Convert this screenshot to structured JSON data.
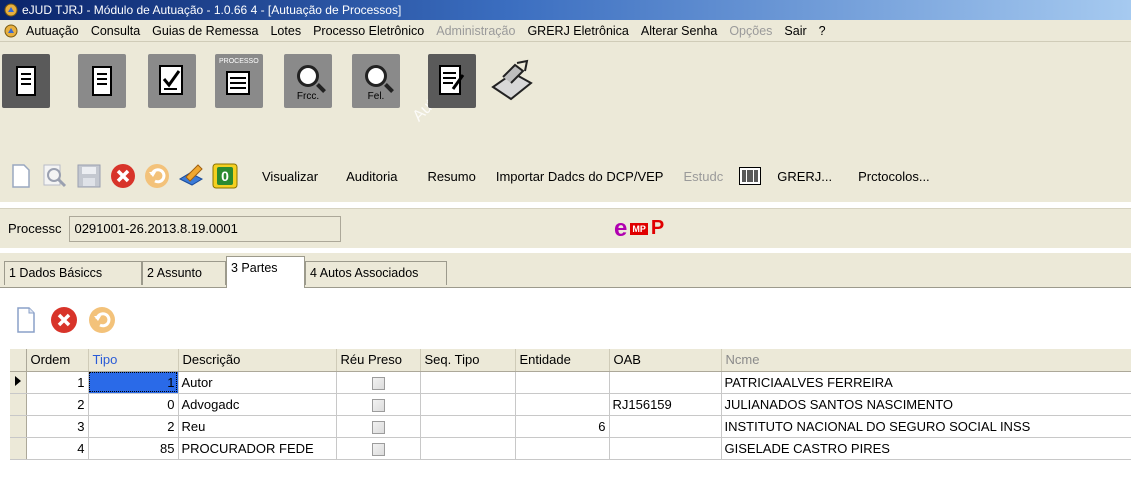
{
  "window": {
    "title": "eJUD TJRJ - Módulo de Autuação - 1.0.66 4 - [Autuação de Processos]"
  },
  "menu": [
    {
      "label": "Autuação",
      "disabled": false
    },
    {
      "label": "Consulta",
      "disabled": false
    },
    {
      "label": "Guias de Remessa",
      "disabled": false
    },
    {
      "label": "Lotes",
      "disabled": false
    },
    {
      "label": "Processo Eletrônico",
      "disabled": false
    },
    {
      "label": "Administração",
      "disabled": true
    },
    {
      "label": "GRERJ Eletrônica",
      "disabled": false
    },
    {
      "label": "Alterar Senha",
      "disabled": false
    },
    {
      "label": "Opções",
      "disabled": true
    },
    {
      "label": "Sair",
      "disabled": false
    },
    {
      "label": "?",
      "disabled": false
    }
  ],
  "big_toolbar": {
    "btn_frcc_label": "Frcc.",
    "btn_fel_label": "Fel.",
    "btn_processo_caption": "PROCESSO",
    "watermark": "Autoc"
  },
  "toolbar2": {
    "visualizar": "Visualizar",
    "auditoria": "Auditoria",
    "resumo": "Resumo",
    "importar": "Importar Dadcs do DCP/VEP",
    "estudo": "Estudc",
    "grerj": "GRERJ...",
    "protocolos": "Prctocolos..."
  },
  "processo": {
    "label": "Processc",
    "value": "0291001-26.2013.8.19.0001",
    "logo_e": "e",
    "logo_mp": "MP",
    "logo_p": "P"
  },
  "tabs": [
    {
      "label": "1 Dados Básiccs",
      "active": false
    },
    {
      "label": "2 Assunto",
      "active": false
    },
    {
      "label": "3 Partes",
      "active": true
    },
    {
      "label": "4 Autos Associados",
      "active": false
    }
  ],
  "grid": {
    "columns": [
      "Ordem",
      "Tipo",
      "Descrição",
      "Réu Preso",
      "Seq. Tipo",
      "Entidade",
      "OAB",
      "Ncme"
    ],
    "rows": [
      {
        "ordem": "1",
        "tipo": "1",
        "descricao": "Autor",
        "seq_tipo": "",
        "entidade": "",
        "oab": "",
        "nome": "PATRICIAALVES FERREIRA"
      },
      {
        "ordem": "2",
        "tipo": "0",
        "descricao": "Advogadc",
        "seq_tipo": "",
        "entidade": "",
        "oab": "RJ156159",
        "nome": "JULIANADOS SANTOS NASCIMENTO"
      },
      {
        "ordem": "3",
        "tipo": "2",
        "descricao": "Reu",
        "seq_tipo": "",
        "entidade": "6",
        "oab": "",
        "nome": "INSTITUTO NACIONAL DO SEGURO SOCIAL INSS"
      },
      {
        "ordem": "4",
        "tipo": "85",
        "descricao": "PROCURADOR FEDE",
        "seq_tipo": "",
        "entidade": "",
        "oab": "",
        "nome": "GISELADE CASTRO PIRES"
      }
    ]
  }
}
